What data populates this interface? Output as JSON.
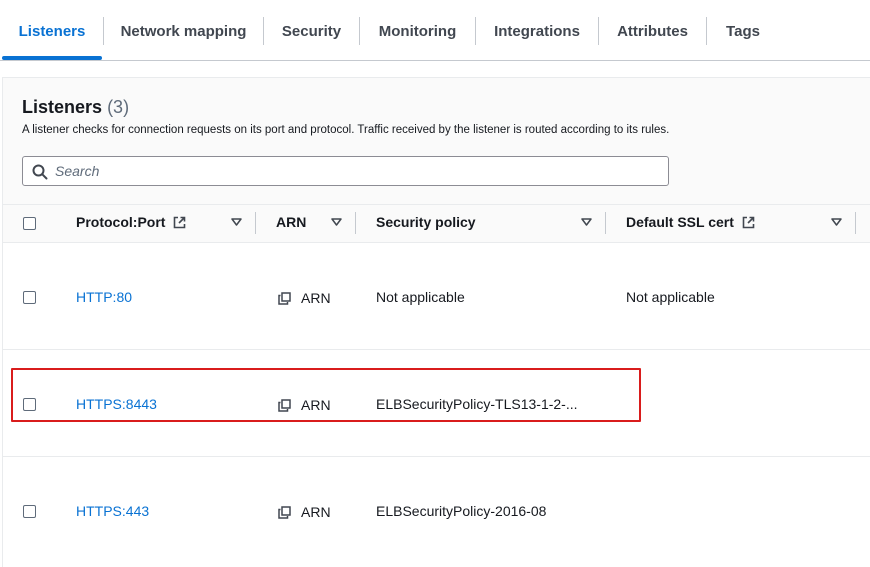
{
  "tabs": [
    {
      "label": "Listeners"
    },
    {
      "label": "Network mapping"
    },
    {
      "label": "Security"
    },
    {
      "label": "Monitoring"
    },
    {
      "label": "Integrations"
    },
    {
      "label": "Attributes"
    },
    {
      "label": "Tags"
    }
  ],
  "listeners": {
    "title": "Listeners",
    "count": "(3)",
    "description": "A listener checks for connection requests on its port and protocol. Traffic received by the listener is routed according to its rules.",
    "search_placeholder": "Search"
  },
  "table": {
    "columns": [
      "Protocol:Port",
      "ARN",
      "Security policy",
      "Default SSL cert"
    ],
    "rows": [
      {
        "protocol_port": "HTTP:80",
        "arn": "ARN",
        "security_policy": "Not applicable",
        "default_ssl_cert": "Not applicable"
      },
      {
        "protocol_port": "HTTPS:8443",
        "arn": "ARN",
        "security_policy": "ELBSecurityPolicy-TLS13-1-2-...",
        "default_ssl_cert": ""
      },
      {
        "protocol_port": "HTTPS:443",
        "arn": "ARN",
        "security_policy": "ELBSecurityPolicy-2016-08",
        "default_ssl_cert": ""
      }
    ]
  },
  "colors": {
    "accent": "#0972d3",
    "highlight_border": "#d91c1c"
  }
}
